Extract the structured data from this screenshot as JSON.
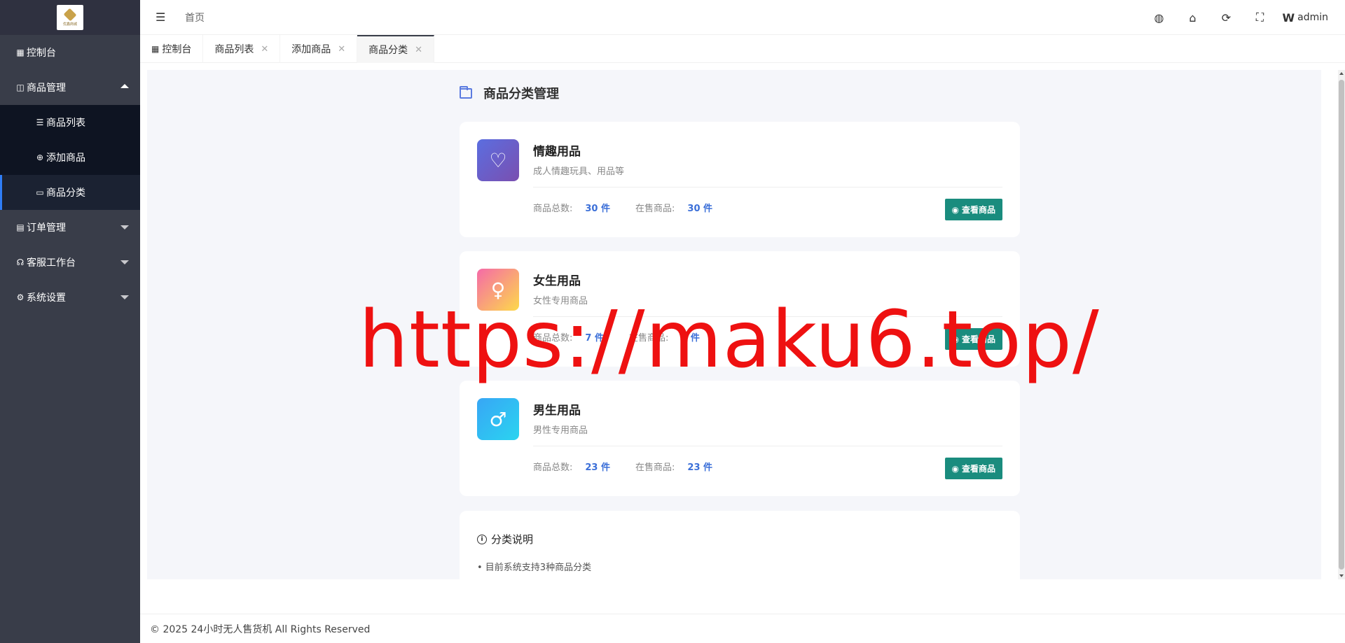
{
  "sidebar": {
    "logo_text": "优鑫商城",
    "items": [
      {
        "label": "控制台",
        "icon": "dashboard-icon"
      },
      {
        "label": "商品管理",
        "icon": "bag-icon"
      },
      {
        "label": "订单管理",
        "icon": "order-icon"
      },
      {
        "label": "客服工作台",
        "icon": "headset-icon"
      },
      {
        "label": "系统设置",
        "icon": "gear-icon"
      }
    ],
    "sub_items": [
      {
        "label": "商品列表",
        "icon": "list-icon"
      },
      {
        "label": "添加商品",
        "icon": "plus-circle-icon"
      },
      {
        "label": "商品分类",
        "icon": "folder-icon"
      }
    ]
  },
  "header": {
    "breadcrumb": "首页",
    "user": "admin"
  },
  "tabs": [
    {
      "label": "控制台"
    },
    {
      "label": "商品列表"
    },
    {
      "label": "添加商品"
    },
    {
      "label": "商品分类"
    }
  ],
  "page": {
    "title": "商品分类管理",
    "stat_total_label": "商品总数:",
    "stat_sale_label": "在售商品:",
    "view_button": "查看商品",
    "categories": [
      {
        "name": "情趣用品",
        "desc": "成人情趣玩具、用品等",
        "total": "30 件",
        "on_sale": "30 件",
        "icon": "heart-icon",
        "color1": "#5b6ee0",
        "color2": "#7a4fb0"
      },
      {
        "name": "女生用品",
        "desc": "女性专用商品",
        "total": "7 件",
        "on_sale": "7 件",
        "icon": "female-icon",
        "color1": "#f56aa8",
        "color2": "#fdd94a"
      },
      {
        "name": "男生用品",
        "desc": "男性专用商品",
        "total": "23 件",
        "on_sale": "23 件",
        "icon": "male-icon",
        "color1": "#38a6f5",
        "color2": "#2ad4f0"
      }
    ],
    "info": {
      "title": "分类说明",
      "line1": "• 目前系统支持3种商品分类"
    }
  },
  "watermark": "https://maku6.top/",
  "footer": "© 2025 24小时无人售货机 All Rights Reserved"
}
